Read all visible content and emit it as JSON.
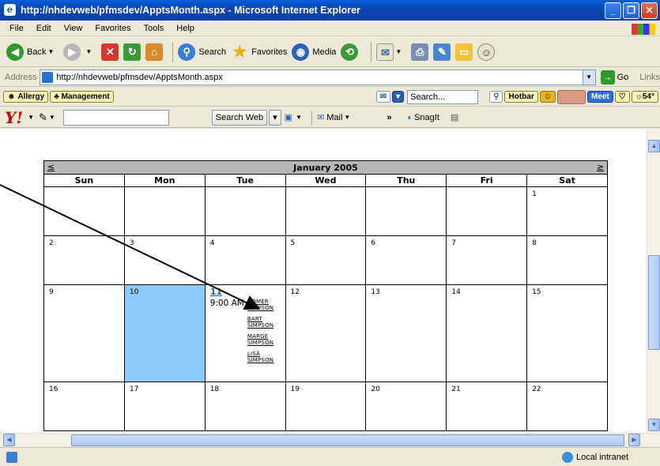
{
  "window": {
    "title": "http://nhdevweb/pfmsdev/ApptsMonth.aspx - Microsoft Internet Explorer"
  },
  "menu": [
    "File",
    "Edit",
    "View",
    "Favorites",
    "Tools",
    "Help"
  ],
  "toolbar": {
    "back": "Back",
    "search": "Search",
    "favorites": "Favorites",
    "media": "Media"
  },
  "address": {
    "label": "Address",
    "url": "http://nhdevweb/pfmsdev/ApptsMonth.aspx",
    "go": "Go",
    "links": "Links"
  },
  "addons": {
    "allergy": "Allergy",
    "management": "Management",
    "search_placeholder": "Search...",
    "hotbar": "Hotbar",
    "meet": "Meet",
    "temp": "54°"
  },
  "yahoo": {
    "logo": "Y!",
    "search_web": "Search Web",
    "mail": "Mail",
    "more": "»",
    "snagit": "SnagIt"
  },
  "calendar": {
    "month": "January 2005",
    "prev": "≤",
    "next": "≥",
    "weekdays": [
      "Sun",
      "Mon",
      "Tue",
      "Wed",
      "Thu",
      "Fri",
      "Sat"
    ],
    "selected_day": "10",
    "today_link": "11",
    "appointment_time": "9:00 AM",
    "appointment_names": [
      [
        "HOMER",
        "SIMPSON"
      ],
      [
        "BART",
        "SIMPSON"
      ],
      [
        "MARGE",
        "SIMPSON"
      ],
      [
        "LISA",
        "SIMPSON"
      ]
    ],
    "weeks": [
      [
        "",
        "",
        "",
        "",
        "",
        "",
        "1"
      ],
      [
        "2",
        "3",
        "4",
        "5",
        "6",
        "7",
        "8"
      ],
      [
        "9",
        "10",
        "11",
        "12",
        "13",
        "14",
        "15"
      ],
      [
        "16",
        "17",
        "18",
        "19",
        "20",
        "21",
        "22"
      ]
    ]
  },
  "status": {
    "zone": "Local intranet"
  }
}
